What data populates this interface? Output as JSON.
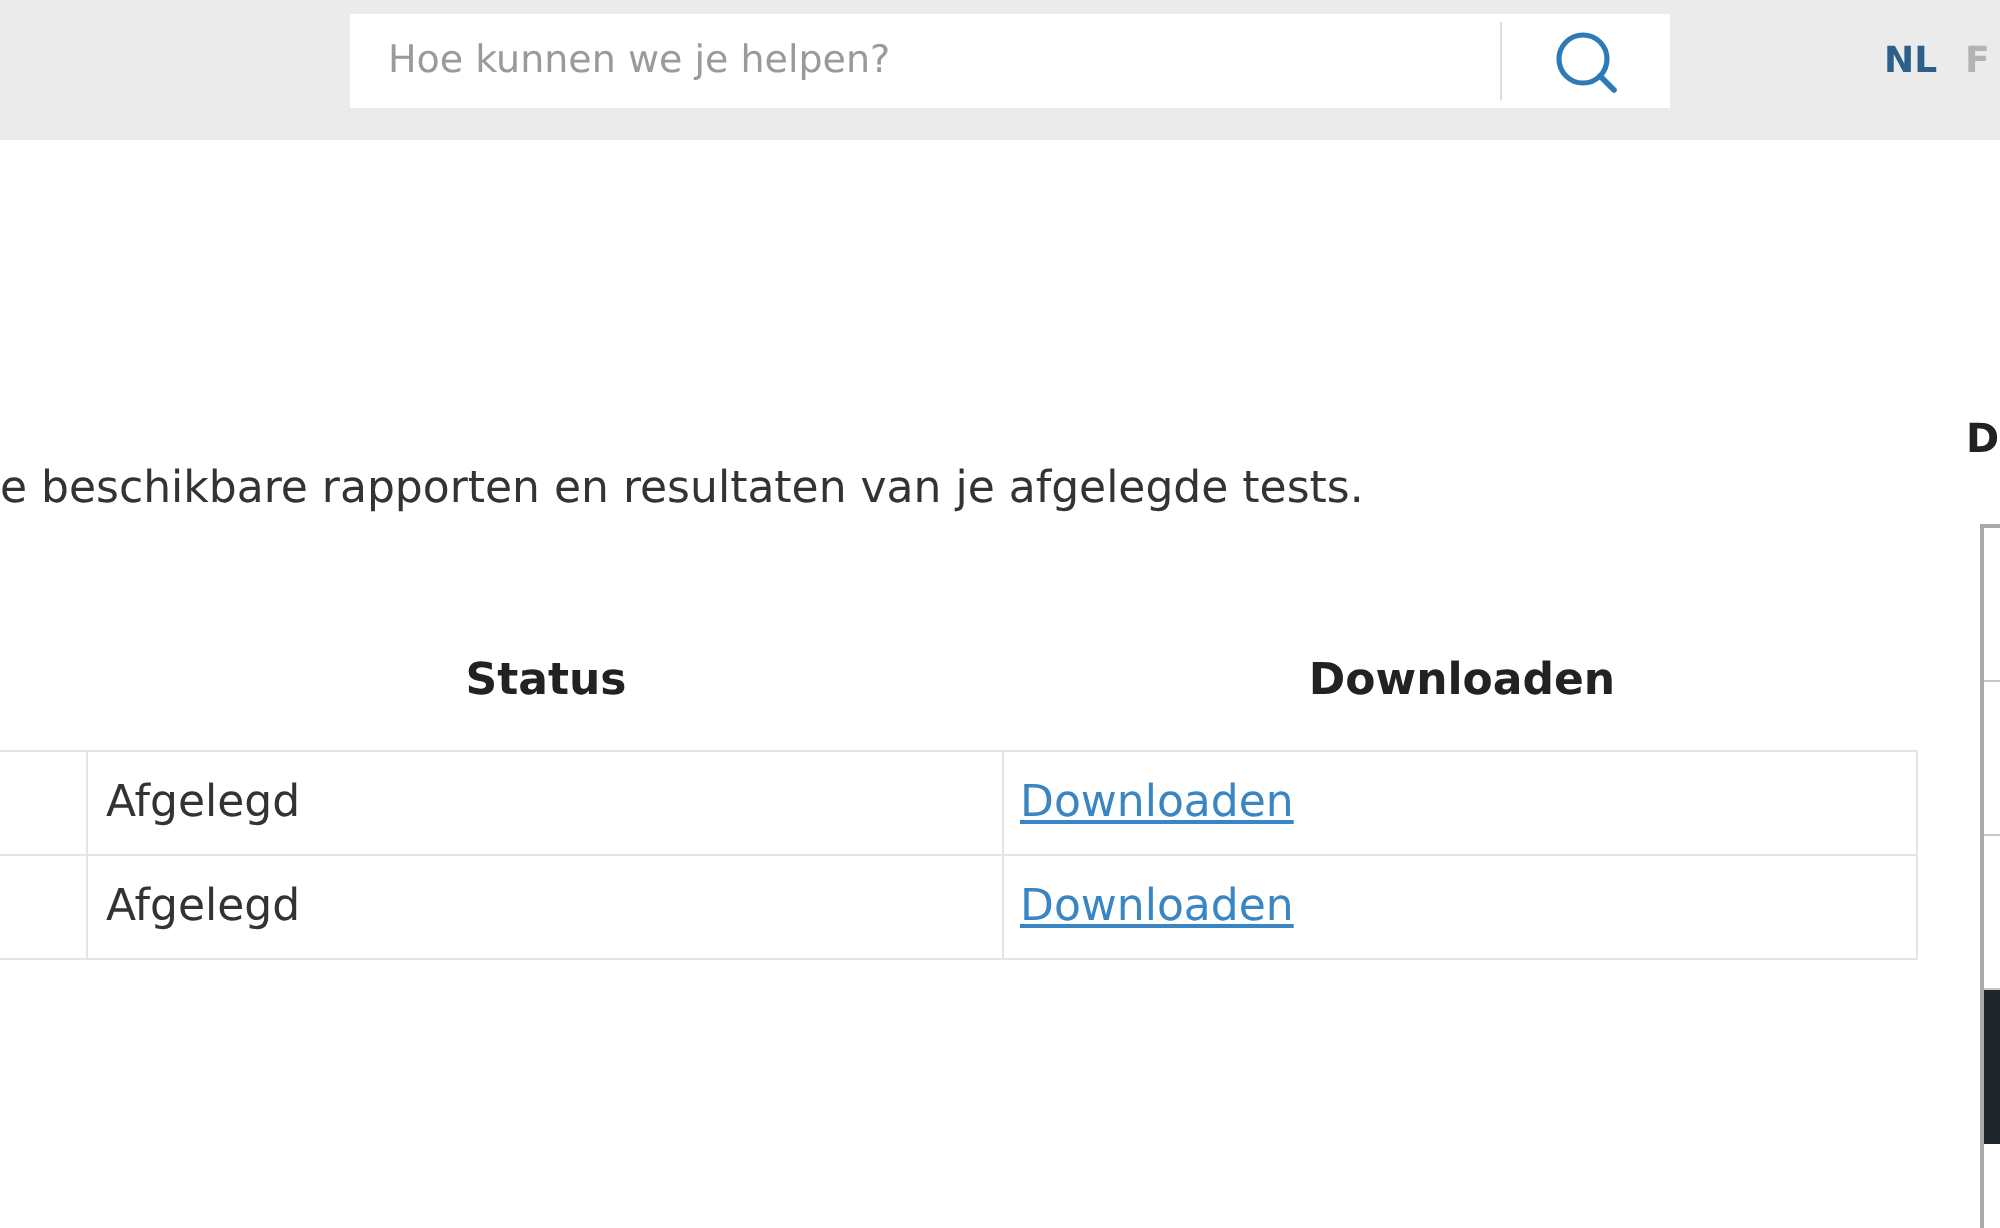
{
  "header": {
    "search": {
      "placeholder": "Hoe kunnen we je helpen?"
    },
    "languages": [
      {
        "label": "NL",
        "selected": true
      },
      {
        "label": "F",
        "selected": false
      }
    ]
  },
  "intro": "e beschikbare rapporten en resultaten van je afgelegde tests.",
  "table": {
    "columns": [
      "Status",
      "Downloaden"
    ],
    "rows": [
      {
        "status": "Afgelegd",
        "download": "Downloaden"
      },
      {
        "status": "Afgelegd",
        "download": "Downloaden"
      }
    ]
  },
  "side_panel": {
    "heading": "D",
    "items": [
      {
        "selected": false
      },
      {
        "selected": false
      },
      {
        "selected": false
      },
      {
        "selected": true
      }
    ]
  }
}
